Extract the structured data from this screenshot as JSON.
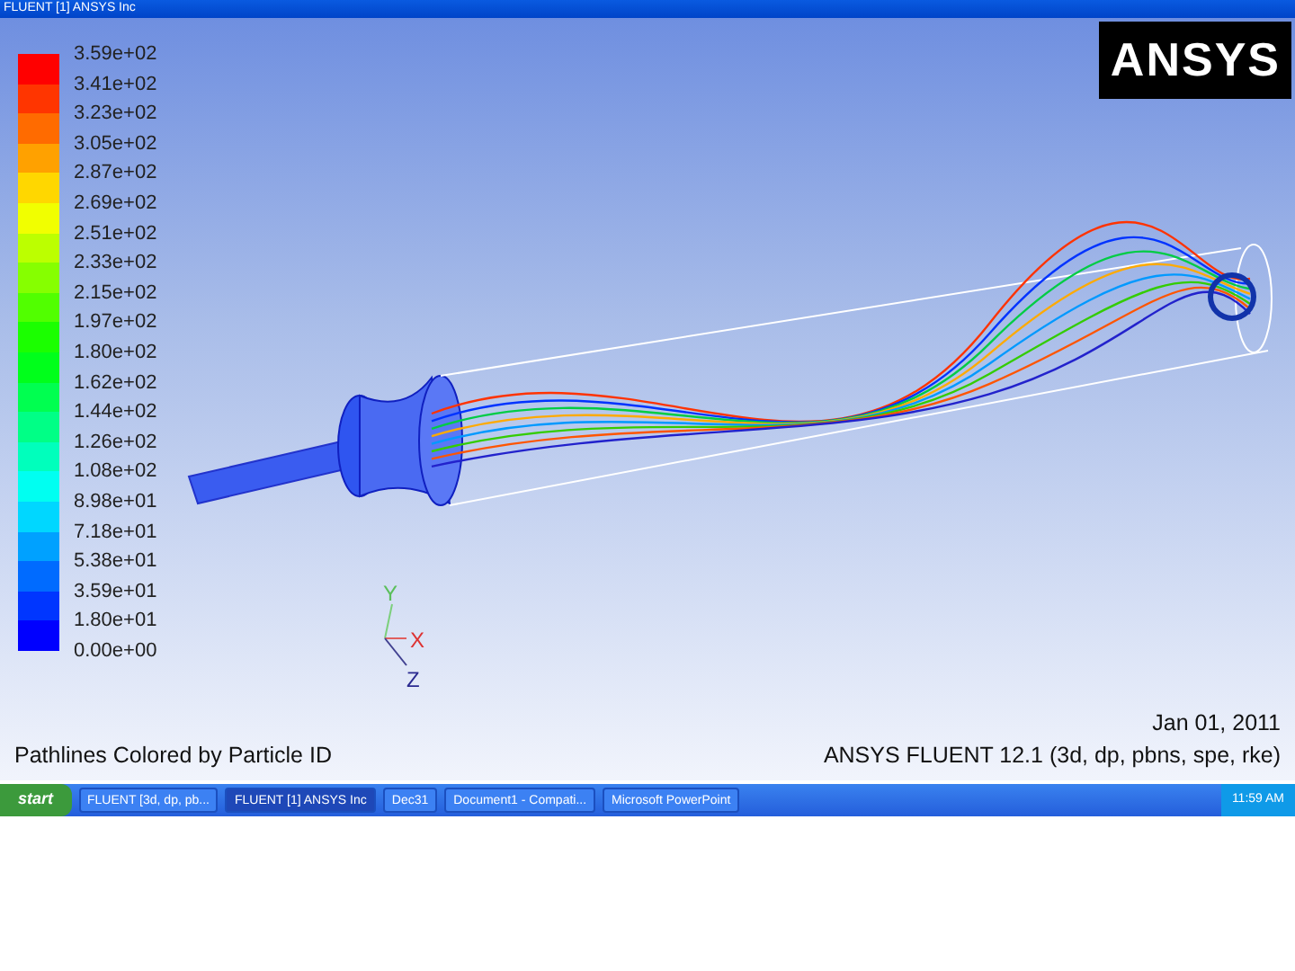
{
  "window": {
    "title": "FLUENT [1] ANSYS Inc"
  },
  "logo": {
    "text": "ANSYS"
  },
  "legend": {
    "labels": [
      "3.59e+02",
      "3.41e+02",
      "3.23e+02",
      "3.05e+02",
      "2.87e+02",
      "2.69e+02",
      "2.51e+02",
      "2.33e+02",
      "2.15e+02",
      "1.97e+02",
      "1.80e+02",
      "1.62e+02",
      "1.44e+02",
      "1.26e+02",
      "1.08e+02",
      "8.98e+01",
      "7.18e+01",
      "5.38e+01",
      "3.59e+01",
      "1.80e+01",
      "0.00e+00"
    ],
    "bands": [
      {
        "color": "#ff0000"
      },
      {
        "color": "#ff3500"
      },
      {
        "color": "#ff6b00"
      },
      {
        "color": "#ffa100"
      },
      {
        "color": "#ffd700"
      },
      {
        "color": "#f1ff00"
      },
      {
        "color": "#bcff00"
      },
      {
        "color": "#86ff00"
      },
      {
        "color": "#51ff00"
      },
      {
        "color": "#1bff00"
      },
      {
        "color": "#00ff1b"
      },
      {
        "color": "#00ff50"
      },
      {
        "color": "#00ff86"
      },
      {
        "color": "#00ffbc"
      },
      {
        "color": "#00fff1"
      },
      {
        "color": "#00d7ff"
      },
      {
        "color": "#00a1ff"
      },
      {
        "color": "#006bff"
      },
      {
        "color": "#0036ff"
      },
      {
        "color": "#0000ff"
      }
    ]
  },
  "axes": {
    "y": "Y",
    "x": "X",
    "z": "Z"
  },
  "footer": {
    "caption": "Pathlines Colored by Particle ID",
    "date": "Jan 01, 2011",
    "version": "ANSYS FLUENT 12.1 (3d, dp, pbns, spe, rke)"
  },
  "taskbar": {
    "start": "start",
    "tasks": [
      {
        "label": "FLUENT [3d, dp, pb...",
        "selected": false
      },
      {
        "label": "FLUENT [1] ANSYS Inc",
        "selected": true
      },
      {
        "label": "Dec31",
        "selected": false
      },
      {
        "label": "Document1 - Compati...",
        "selected": false
      },
      {
        "label": "Microsoft PowerPoint",
        "selected": false
      }
    ],
    "clock": "11:59 AM"
  }
}
